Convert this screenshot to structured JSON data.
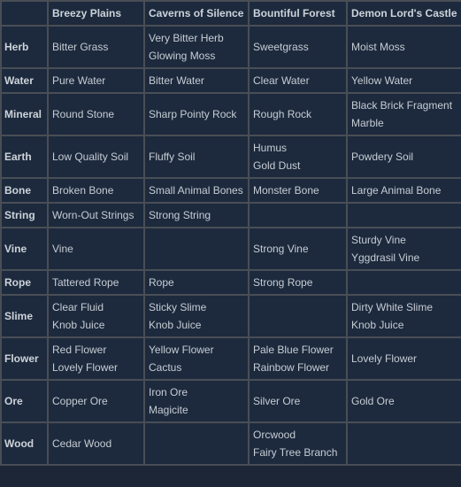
{
  "table": {
    "headers": [
      "",
      "Breezy Plains",
      "Caverns of Silence",
      "Bountiful Forest",
      "Demon Lord's Castle"
    ],
    "rows": [
      {
        "category": "Herb",
        "cells": [
          [
            "Bitter Grass"
          ],
          [
            "Very Bitter Herb",
            "Glowing Moss"
          ],
          [
            "Sweetgrass"
          ],
          [
            "Moist Moss"
          ]
        ]
      },
      {
        "category": "Water",
        "cells": [
          [
            "Pure Water"
          ],
          [
            "Bitter Water"
          ],
          [
            "Clear Water"
          ],
          [
            "Yellow Water"
          ]
        ]
      },
      {
        "category": "Mineral",
        "cells": [
          [
            "Round Stone"
          ],
          [
            "Sharp Pointy Rock"
          ],
          [
            "Rough Rock"
          ],
          [
            "Black Brick Fragment",
            "Marble"
          ]
        ]
      },
      {
        "category": "Earth",
        "cells": [
          [
            "Low Quality Soil"
          ],
          [
            "Fluffy Soil"
          ],
          [
            "Humus",
            "Gold Dust"
          ],
          [
            "Powdery Soil"
          ]
        ]
      },
      {
        "category": "Bone",
        "cells": [
          [
            "Broken Bone"
          ],
          [
            "Small Animal Bones"
          ],
          [
            "Monster Bone"
          ],
          [
            "Large Animal Bone"
          ]
        ]
      },
      {
        "category": "String",
        "cells": [
          [
            "Worn-Out Strings"
          ],
          [
            "Strong String"
          ],
          [],
          []
        ]
      },
      {
        "category": "Vine",
        "cells": [
          [
            "Vine"
          ],
          [],
          [
            "Strong Vine"
          ],
          [
            "Sturdy Vine",
            "Yggdrasil Vine"
          ]
        ]
      },
      {
        "category": "Rope",
        "cells": [
          [
            "Tattered Rope"
          ],
          [
            "Rope"
          ],
          [
            "Strong Rope"
          ],
          []
        ]
      },
      {
        "category": "Slime",
        "cells": [
          [
            "Clear Fluid",
            "Knob Juice"
          ],
          [
            "Sticky Slime",
            "Knob Juice"
          ],
          [],
          [
            "Dirty White Slime",
            "Knob Juice"
          ]
        ]
      },
      {
        "category": "Flower",
        "cells": [
          [
            "Red Flower",
            "Lovely Flower"
          ],
          [
            "Yellow Flower",
            "Cactus"
          ],
          [
            "Pale Blue Flower",
            "Rainbow Flower"
          ],
          [
            "Lovely Flower"
          ]
        ]
      },
      {
        "category": "Ore",
        "cells": [
          [
            "Copper Ore"
          ],
          [
            "Iron Ore",
            "Magicite"
          ],
          [
            "Silver Ore"
          ],
          [
            "Gold Ore"
          ]
        ]
      },
      {
        "category": "Wood",
        "cells": [
          [
            "Cedar Wood"
          ],
          [],
          [
            "Orcwood",
            "Fairy Tree Branch"
          ],
          []
        ]
      }
    ]
  },
  "colors": {
    "cell_background": "#1d2a3d",
    "border": "#494e55",
    "text": "#c6ccd4"
  }
}
